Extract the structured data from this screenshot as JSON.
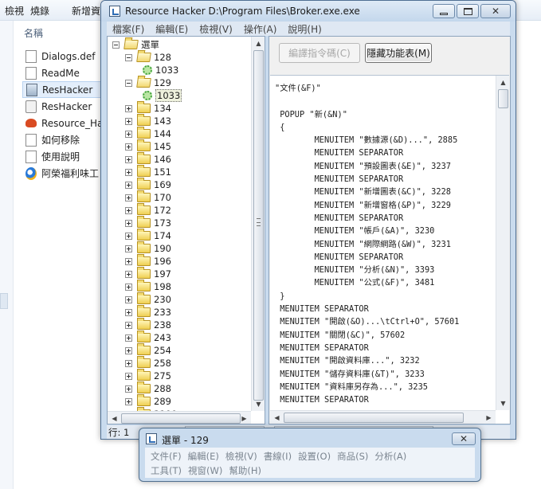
{
  "explorer": {
    "toolbar": [
      "檢視",
      "燒錄",
      "新增資"
    ],
    "column_header": "名稱",
    "files": [
      {
        "name": "Dialogs.def",
        "icon": "document-icon"
      },
      {
        "name": "ReadMe",
        "icon": "document-icon"
      },
      {
        "name": "ResHacker",
        "icon": "reshacker-app-icon",
        "selected": true
      },
      {
        "name": "ResHacker",
        "icon": "config-file-icon"
      },
      {
        "name": "Resource_Ha",
        "icon": "crab-icon"
      },
      {
        "name": "如何移除",
        "icon": "document-icon"
      },
      {
        "name": "使用說明",
        "icon": "document-icon"
      },
      {
        "name": "阿榮福利味工",
        "icon": "browser-icon"
      }
    ]
  },
  "window": {
    "title": "Resource Hacker   D:\\Program Files\\Broker.exe.exe",
    "menu": [
      "檔案(F)",
      "編輯(E)",
      "檢視(V)",
      "操作(A)",
      "說明(H)"
    ],
    "buttons": {
      "compile": "編譯指令碼(C)",
      "hide": "隱藏功能表(M)"
    }
  },
  "tree": {
    "root": "選單",
    "expanded": [
      {
        "label": "128",
        "child": "1033"
      },
      {
        "label": "129",
        "child": "1033"
      }
    ],
    "collapsed": [
      "134",
      "143",
      "144",
      "145",
      "146",
      "151",
      "169",
      "170",
      "172",
      "173",
      "174",
      "190",
      "196",
      "197",
      "198",
      "230",
      "233",
      "238",
      "243",
      "254",
      "258",
      "275",
      "288",
      "289",
      "3100"
    ]
  },
  "code": [
    "\"文件(&F)\"",
    "",
    " POPUP \"新(&N)\"",
    " {",
    "        MENUITEM \"數據源(&D)...\", 2885",
    "        MENUITEM SEPARATOR",
    "        MENUITEM \"預設圖表(&E)\", 3237",
    "        MENUITEM SEPARATOR",
    "        MENUITEM \"新增圖表(&C)\", 3228",
    "        MENUITEM \"新增窗格(&P)\", 3229",
    "        MENUITEM SEPARATOR",
    "        MENUITEM \"帳戶(&A)\", 3230",
    "        MENUITEM \"網際網路(&W)\", 3231",
    "        MENUITEM SEPARATOR",
    "        MENUITEM \"分析(&N)\", 3393",
    "        MENUITEM \"公式(&F)\", 3481",
    " }",
    " MENUITEM SEPARATOR",
    " MENUITEM \"開啟(&O)...\\tCtrl+O\", 57601",
    " MENUITEM \"關閉(&C)\", 57602",
    " MENUITEM SEPARATOR",
    " MENUITEM \"開啟資料庫...\", 3232",
    " MENUITEM \"儲存資料庫(&T)\", 3233",
    " MENUITEM \"資料庫另存為...\", 3235",
    " MENUITEM SEPARATOR"
  ],
  "status": {
    "text": "行: 1"
  },
  "preview": {
    "title": "選單 - 129",
    "menu_row1": [
      "文件(F)",
      "編輯(E)",
      "檢視(V)",
      "書線(I)",
      "設置(O)",
      "商品(S)",
      "分析(A)"
    ],
    "menu_row2": [
      "工具(T)",
      "視窗(W)",
      "幫助(H)"
    ]
  }
}
